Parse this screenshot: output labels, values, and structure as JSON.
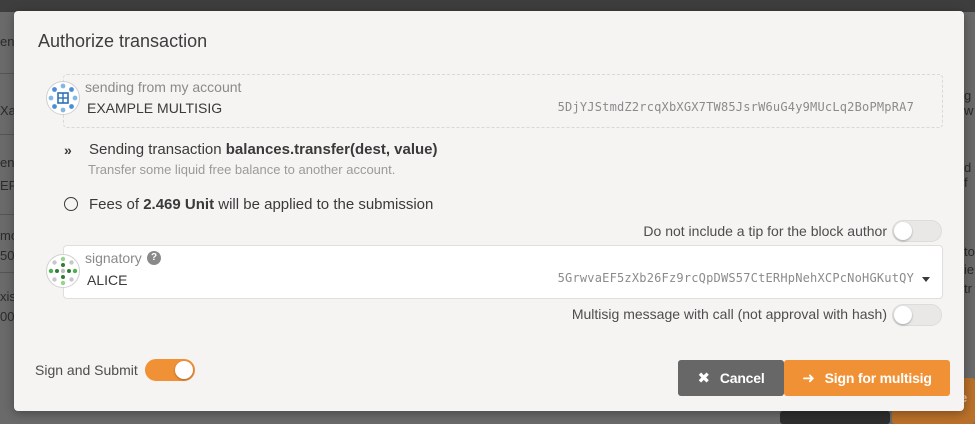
{
  "background": {
    "fragments": [
      "enc",
      "Xa",
      "enc",
      "EF",
      "mo",
      "50",
      "xis",
      "00",
      "g w",
      "d f",
      "to",
      "ie",
      "tr",
      "e"
    ]
  },
  "modal": {
    "title": "Authorize transaction",
    "account": {
      "label": "sending from my account",
      "name": "EXAMPLE MULTISIG",
      "address": "5DjYJStmdZ2rcqXbXGX7TW85JsrW6uG4y9MUcLq2BoPMpRA7",
      "icon": "identicon-multisig"
    },
    "transaction": {
      "prefix": "Sending transaction",
      "call": "balances.transfer(dest, value)",
      "description": "Transfer some liquid free balance to another account.",
      "icon": "double-chevron-right-icon"
    },
    "fees": {
      "prefix": "Fees of",
      "amount": "2.469 Unit",
      "suffix": "will be applied to the submission",
      "icon": "circle-icon"
    },
    "tip_toggle": {
      "label": "Do not include a tip for the block author",
      "on": false
    },
    "signatory": {
      "label": "signatory",
      "name": "ALICE",
      "address": "5GrwvaEF5zXb26Fz9rcQpDWS57CtERHpNehXCPcNoHGKutQY",
      "icon": "identicon-alice"
    },
    "multisig_toggle": {
      "label": "Multisig message with call (not approval with hash)",
      "on": false
    },
    "sign_submit_toggle": {
      "label": "Sign and Submit",
      "on": true
    },
    "buttons": {
      "cancel": "Cancel",
      "sign": "Sign for multisig"
    },
    "colors": {
      "accent": "#f19135",
      "cancel": "#676767"
    }
  }
}
